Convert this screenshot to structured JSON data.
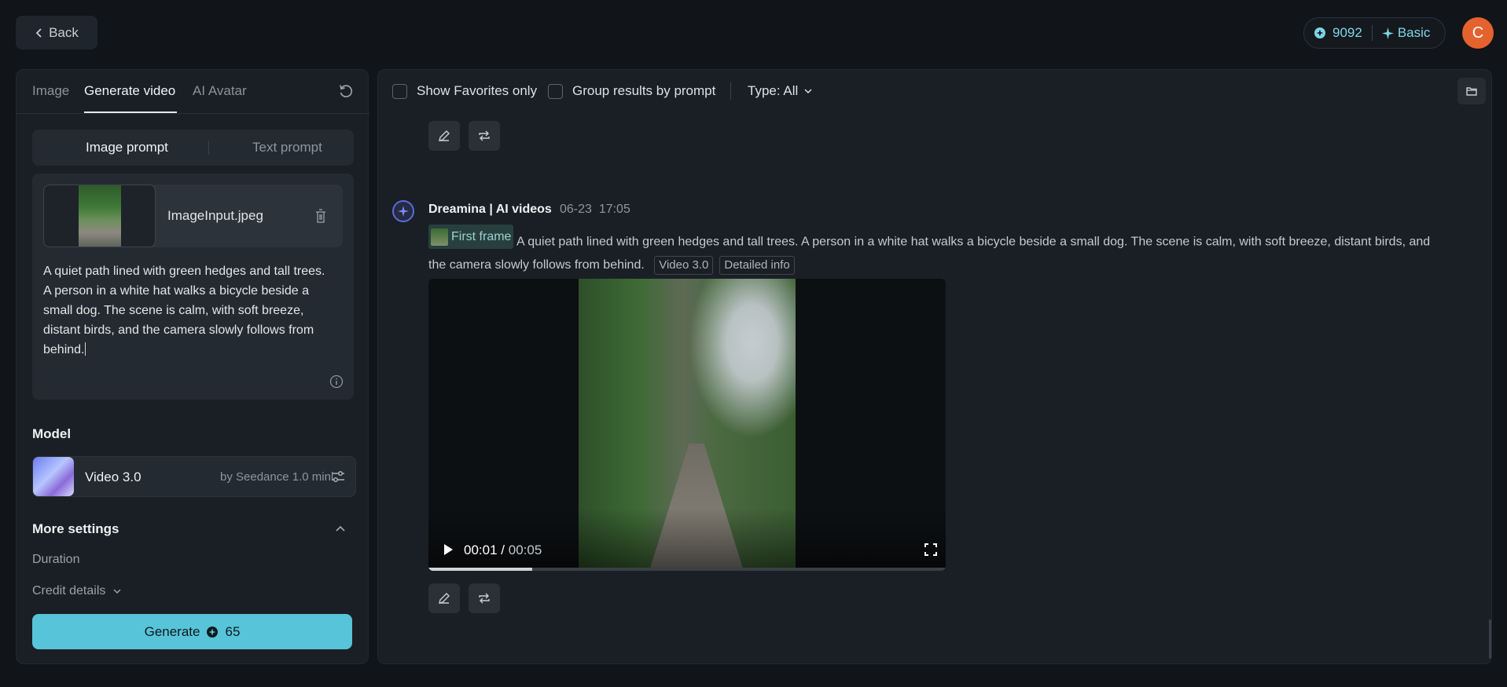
{
  "header": {
    "back_label": "Back",
    "credits": "9092",
    "plan": "Basic",
    "avatar_letter": "C"
  },
  "left": {
    "tabs": [
      {
        "label": "Image"
      },
      {
        "label": "Generate video"
      },
      {
        "label": "AI Avatar"
      }
    ],
    "prompt_modes": {
      "image": "Image prompt",
      "text": "Text prompt"
    },
    "file_name": "ImageInput.jpeg",
    "prompt_text": "A quiet path lined with green hedges and tall trees. A person in a white hat walks a bicycle beside a small dog. The scene is calm, with soft breeze, distant birds, and the camera slowly follows from behind.",
    "model_label": "Model",
    "model": {
      "name": "Video 3.0",
      "by": "by Seedance 1.0 mini"
    },
    "more_settings": "More settings",
    "duration_label": "Duration",
    "credit_details": "Credit details",
    "generate": {
      "label": "Generate",
      "cost": "65"
    }
  },
  "right": {
    "filters": {
      "favorites": "Show Favorites only",
      "group": "Group results by prompt",
      "type": "Type: All"
    },
    "message": {
      "author": "Dreamina | AI videos",
      "date": "06-23",
      "time": "17:05",
      "first_frame": "First frame",
      "prompt": "A quiet path lined with green hedges and tall trees. A person in a white hat walks a bicycle beside a small dog. The scene is calm, with soft breeze, distant birds, and the camera slowly follows from behind.",
      "tags": [
        "Video 3.0",
        "Detailed info"
      ]
    },
    "video": {
      "current": "00:01",
      "separator": "/",
      "duration": "00:05",
      "progress_fraction": 0.2
    }
  },
  "colors": {
    "accent": "#57c4d9",
    "avatar": "#e4622e",
    "background": "#111418",
    "panel": "#1a1f25"
  }
}
